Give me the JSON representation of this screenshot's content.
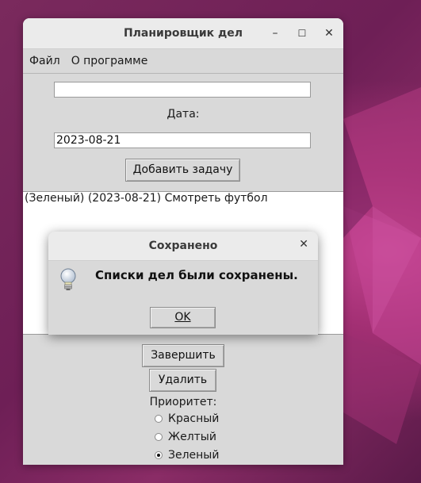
{
  "window": {
    "title": "Планировщик дел",
    "controls": {
      "minimize": "–",
      "maximize": "☐",
      "close": "✕"
    }
  },
  "menu": {
    "items": [
      "Файл",
      "О программе"
    ]
  },
  "form": {
    "task_value": "",
    "date_label": "Дата:",
    "date_value": "2023-08-21",
    "add_button": "Добавить задачу"
  },
  "tasks": [
    "(Зеленый) (2023-08-21) Смотреть футбол"
  ],
  "actions": {
    "complete_button": "Завершить",
    "delete_button": "Удалить"
  },
  "priority": {
    "label": "Приоритет:",
    "options": [
      "Красный",
      "Желтый",
      "Зеленый"
    ],
    "selected": "Зеленый"
  },
  "dialog": {
    "title": "Сохранено",
    "close": "✕",
    "message": "Списки дел были сохранены.",
    "ok_button": "OK",
    "icon": "lightbulb-icon"
  }
}
